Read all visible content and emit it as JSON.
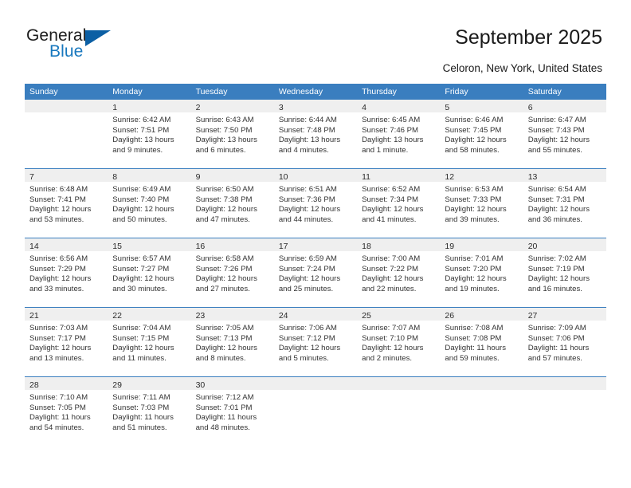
{
  "brand": {
    "name_part1": "General",
    "name_part2": "Blue"
  },
  "header": {
    "title": "September 2025",
    "location": "Celoron, New York, United States"
  },
  "calendar": {
    "colors": {
      "header_blue": "#3a7ebf",
      "daynum_band": "#efefef",
      "brand_dark": "#1c1c1c",
      "brand_blue": "#1878be",
      "logo_triangle": "#0b5fa4"
    },
    "weekday_headers": [
      "Sunday",
      "Monday",
      "Tuesday",
      "Wednesday",
      "Thursday",
      "Friday",
      "Saturday"
    ],
    "weeks": [
      [
        {
          "empty": true
        },
        {
          "day": "1",
          "sunrise": "Sunrise: 6:42 AM",
          "sunset": "Sunset: 7:51 PM",
          "daylight1": "Daylight: 13 hours",
          "daylight2": "and 9 minutes."
        },
        {
          "day": "2",
          "sunrise": "Sunrise: 6:43 AM",
          "sunset": "Sunset: 7:50 PM",
          "daylight1": "Daylight: 13 hours",
          "daylight2": "and 6 minutes."
        },
        {
          "day": "3",
          "sunrise": "Sunrise: 6:44 AM",
          "sunset": "Sunset: 7:48 PM",
          "daylight1": "Daylight: 13 hours",
          "daylight2": "and 4 minutes."
        },
        {
          "day": "4",
          "sunrise": "Sunrise: 6:45 AM",
          "sunset": "Sunset: 7:46 PM",
          "daylight1": "Daylight: 13 hours",
          "daylight2": "and 1 minute."
        },
        {
          "day": "5",
          "sunrise": "Sunrise: 6:46 AM",
          "sunset": "Sunset: 7:45 PM",
          "daylight1": "Daylight: 12 hours",
          "daylight2": "and 58 minutes."
        },
        {
          "day": "6",
          "sunrise": "Sunrise: 6:47 AM",
          "sunset": "Sunset: 7:43 PM",
          "daylight1": "Daylight: 12 hours",
          "daylight2": "and 55 minutes."
        }
      ],
      [
        {
          "day": "7",
          "sunrise": "Sunrise: 6:48 AM",
          "sunset": "Sunset: 7:41 PM",
          "daylight1": "Daylight: 12 hours",
          "daylight2": "and 53 minutes."
        },
        {
          "day": "8",
          "sunrise": "Sunrise: 6:49 AM",
          "sunset": "Sunset: 7:40 PM",
          "daylight1": "Daylight: 12 hours",
          "daylight2": "and 50 minutes."
        },
        {
          "day": "9",
          "sunrise": "Sunrise: 6:50 AM",
          "sunset": "Sunset: 7:38 PM",
          "daylight1": "Daylight: 12 hours",
          "daylight2": "and 47 minutes."
        },
        {
          "day": "10",
          "sunrise": "Sunrise: 6:51 AM",
          "sunset": "Sunset: 7:36 PM",
          "daylight1": "Daylight: 12 hours",
          "daylight2": "and 44 minutes."
        },
        {
          "day": "11",
          "sunrise": "Sunrise: 6:52 AM",
          "sunset": "Sunset: 7:34 PM",
          "daylight1": "Daylight: 12 hours",
          "daylight2": "and 41 minutes."
        },
        {
          "day": "12",
          "sunrise": "Sunrise: 6:53 AM",
          "sunset": "Sunset: 7:33 PM",
          "daylight1": "Daylight: 12 hours",
          "daylight2": "and 39 minutes."
        },
        {
          "day": "13",
          "sunrise": "Sunrise: 6:54 AM",
          "sunset": "Sunset: 7:31 PM",
          "daylight1": "Daylight: 12 hours",
          "daylight2": "and 36 minutes."
        }
      ],
      [
        {
          "day": "14",
          "sunrise": "Sunrise: 6:56 AM",
          "sunset": "Sunset: 7:29 PM",
          "daylight1": "Daylight: 12 hours",
          "daylight2": "and 33 minutes."
        },
        {
          "day": "15",
          "sunrise": "Sunrise: 6:57 AM",
          "sunset": "Sunset: 7:27 PM",
          "daylight1": "Daylight: 12 hours",
          "daylight2": "and 30 minutes."
        },
        {
          "day": "16",
          "sunrise": "Sunrise: 6:58 AM",
          "sunset": "Sunset: 7:26 PM",
          "daylight1": "Daylight: 12 hours",
          "daylight2": "and 27 minutes."
        },
        {
          "day": "17",
          "sunrise": "Sunrise: 6:59 AM",
          "sunset": "Sunset: 7:24 PM",
          "daylight1": "Daylight: 12 hours",
          "daylight2": "and 25 minutes."
        },
        {
          "day": "18",
          "sunrise": "Sunrise: 7:00 AM",
          "sunset": "Sunset: 7:22 PM",
          "daylight1": "Daylight: 12 hours",
          "daylight2": "and 22 minutes."
        },
        {
          "day": "19",
          "sunrise": "Sunrise: 7:01 AM",
          "sunset": "Sunset: 7:20 PM",
          "daylight1": "Daylight: 12 hours",
          "daylight2": "and 19 minutes."
        },
        {
          "day": "20",
          "sunrise": "Sunrise: 7:02 AM",
          "sunset": "Sunset: 7:19 PM",
          "daylight1": "Daylight: 12 hours",
          "daylight2": "and 16 minutes."
        }
      ],
      [
        {
          "day": "21",
          "sunrise": "Sunrise: 7:03 AM",
          "sunset": "Sunset: 7:17 PM",
          "daylight1": "Daylight: 12 hours",
          "daylight2": "and 13 minutes."
        },
        {
          "day": "22",
          "sunrise": "Sunrise: 7:04 AM",
          "sunset": "Sunset: 7:15 PM",
          "daylight1": "Daylight: 12 hours",
          "daylight2": "and 11 minutes."
        },
        {
          "day": "23",
          "sunrise": "Sunrise: 7:05 AM",
          "sunset": "Sunset: 7:13 PM",
          "daylight1": "Daylight: 12 hours",
          "daylight2": "and 8 minutes."
        },
        {
          "day": "24",
          "sunrise": "Sunrise: 7:06 AM",
          "sunset": "Sunset: 7:12 PM",
          "daylight1": "Daylight: 12 hours",
          "daylight2": "and 5 minutes."
        },
        {
          "day": "25",
          "sunrise": "Sunrise: 7:07 AM",
          "sunset": "Sunset: 7:10 PM",
          "daylight1": "Daylight: 12 hours",
          "daylight2": "and 2 minutes."
        },
        {
          "day": "26",
          "sunrise": "Sunrise: 7:08 AM",
          "sunset": "Sunset: 7:08 PM",
          "daylight1": "Daylight: 11 hours",
          "daylight2": "and 59 minutes."
        },
        {
          "day": "27",
          "sunrise": "Sunrise: 7:09 AM",
          "sunset": "Sunset: 7:06 PM",
          "daylight1": "Daylight: 11 hours",
          "daylight2": "and 57 minutes."
        }
      ],
      [
        {
          "day": "28",
          "sunrise": "Sunrise: 7:10 AM",
          "sunset": "Sunset: 7:05 PM",
          "daylight1": "Daylight: 11 hours",
          "daylight2": "and 54 minutes."
        },
        {
          "day": "29",
          "sunrise": "Sunrise: 7:11 AM",
          "sunset": "Sunset: 7:03 PM",
          "daylight1": "Daylight: 11 hours",
          "daylight2": "and 51 minutes."
        },
        {
          "day": "30",
          "sunrise": "Sunrise: 7:12 AM",
          "sunset": "Sunset: 7:01 PM",
          "daylight1": "Daylight: 11 hours",
          "daylight2": "and 48 minutes."
        },
        {
          "empty": true
        },
        {
          "empty": true
        },
        {
          "empty": true
        },
        {
          "empty": true
        }
      ]
    ]
  }
}
